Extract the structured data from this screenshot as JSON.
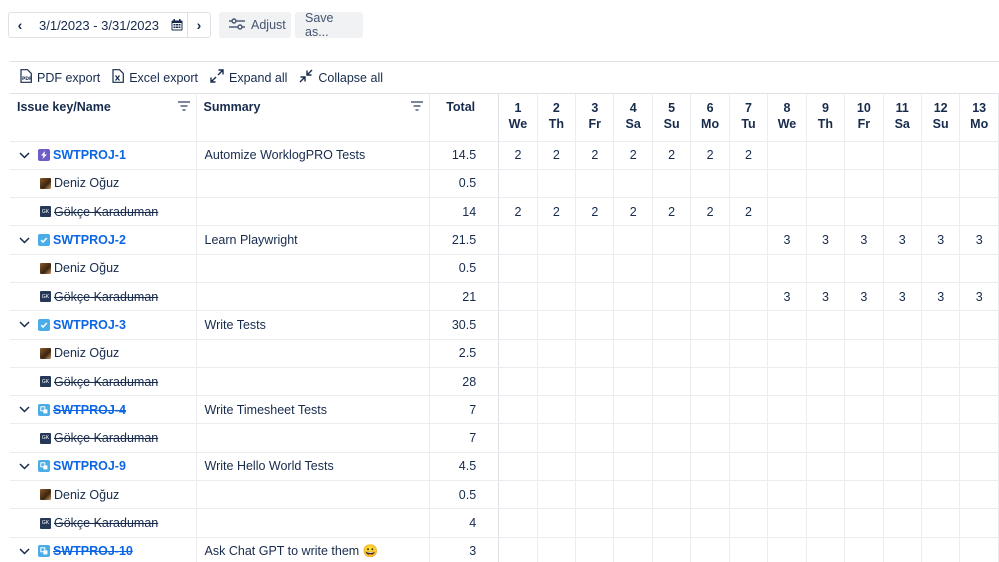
{
  "toolbar": {
    "prev_label": "‹",
    "date_range": "3/1/2023 - 3/31/2023",
    "next_label": "›",
    "adjust_label": "Adjust",
    "save_as_label": "Save as..."
  },
  "export_bar": {
    "pdf_label": "PDF export",
    "excel_label": "Excel export",
    "expand_label": "Expand all",
    "collapse_label": "Collapse all"
  },
  "table": {
    "headers": {
      "key": "Issue key/Name",
      "summary": "Summary",
      "total": "Total"
    },
    "days": [
      {
        "num": "1",
        "dow": "We"
      },
      {
        "num": "2",
        "dow": "Th"
      },
      {
        "num": "3",
        "dow": "Fr"
      },
      {
        "num": "4",
        "dow": "Sa"
      },
      {
        "num": "5",
        "dow": "Su"
      },
      {
        "num": "6",
        "dow": "Mo"
      },
      {
        "num": "7",
        "dow": "Tu"
      },
      {
        "num": "8",
        "dow": "We"
      },
      {
        "num": "9",
        "dow": "Th"
      },
      {
        "num": "10",
        "dow": "Fr"
      },
      {
        "num": "11",
        "dow": "Sa"
      },
      {
        "num": "12",
        "dow": "Su"
      },
      {
        "num": "13",
        "dow": "Mo"
      }
    ],
    "rows": [
      {
        "kind": "issue",
        "key": "SWTPROJ-1",
        "icon": "epic-icon",
        "icon_color": "#6e5dc6",
        "strike": false,
        "summary": "Automize WorklogPRO Tests",
        "total": "14.5",
        "days": [
          "2",
          "2",
          "2",
          "2",
          "2",
          "2",
          "2",
          "",
          "",
          "",
          "",
          "",
          ""
        ]
      },
      {
        "kind": "user",
        "name": "Deniz Oğuz",
        "avatar": "photo",
        "strike": false,
        "total": "0.5",
        "days": [
          "",
          "",
          "",
          "",
          "",
          "",
          "",
          "",
          "",
          "",
          "",
          "",
          ""
        ]
      },
      {
        "kind": "user",
        "name": "Gökçe Karaduman",
        "avatar": "GK",
        "strike": true,
        "total": "14",
        "days": [
          "2",
          "2",
          "2",
          "2",
          "2",
          "2",
          "2",
          "",
          "",
          "",
          "",
          "",
          ""
        ]
      },
      {
        "kind": "issue",
        "key": "SWTPROJ-2",
        "icon": "task-icon",
        "icon_color": "#4bade8",
        "strike": false,
        "summary": "Learn Playwright",
        "total": "21.5",
        "days": [
          "",
          "",
          "",
          "",
          "",
          "",
          "",
          "3",
          "3",
          "3",
          "3",
          "3",
          "3"
        ]
      },
      {
        "kind": "user",
        "name": "Deniz Oğuz",
        "avatar": "photo",
        "strike": false,
        "total": "0.5",
        "days": [
          "",
          "",
          "",
          "",
          "",
          "",
          "",
          "",
          "",
          "",
          "",
          "",
          ""
        ]
      },
      {
        "kind": "user",
        "name": "Gökçe Karaduman",
        "avatar": "GK",
        "strike": true,
        "total": "21",
        "days": [
          "",
          "",
          "",
          "",
          "",
          "",
          "",
          "3",
          "3",
          "3",
          "3",
          "3",
          "3"
        ]
      },
      {
        "kind": "issue",
        "key": "SWTPROJ-3",
        "icon": "task-icon",
        "icon_color": "#4bade8",
        "strike": false,
        "summary": "Write Tests",
        "total": "30.5",
        "days": [
          "",
          "",
          "",
          "",
          "",
          "",
          "",
          "",
          "",
          "",
          "",
          "",
          ""
        ]
      },
      {
        "kind": "user",
        "name": "Deniz Oğuz",
        "avatar": "photo",
        "strike": false,
        "total": "2.5",
        "days": [
          "",
          "",
          "",
          "",
          "",
          "",
          "",
          "",
          "",
          "",
          "",
          "",
          ""
        ]
      },
      {
        "kind": "user",
        "name": "Gökçe Karaduman",
        "avatar": "GK",
        "strike": true,
        "total": "28",
        "days": [
          "",
          "",
          "",
          "",
          "",
          "",
          "",
          "",
          "",
          "",
          "",
          "",
          ""
        ]
      },
      {
        "kind": "issue",
        "key": "SWTPROJ-4",
        "icon": "subtask-icon",
        "icon_color": "#4bade8",
        "strike": true,
        "summary": "Write Timesheet Tests",
        "total": "7",
        "days": [
          "",
          "",
          "",
          "",
          "",
          "",
          "",
          "",
          "",
          "",
          "",
          "",
          ""
        ]
      },
      {
        "kind": "user",
        "name": "Gökçe Karaduman",
        "avatar": "GK",
        "strike": true,
        "total": "7",
        "days": [
          "",
          "",
          "",
          "",
          "",
          "",
          "",
          "",
          "",
          "",
          "",
          "",
          ""
        ]
      },
      {
        "kind": "issue",
        "key": "SWTPROJ-9",
        "icon": "subtask-icon",
        "icon_color": "#4bade8",
        "strike": false,
        "summary": "Write Hello World Tests",
        "total": "4.5",
        "days": [
          "",
          "",
          "",
          "",
          "",
          "",
          "",
          "",
          "",
          "",
          "",
          "",
          ""
        ]
      },
      {
        "kind": "user",
        "name": "Deniz Oğuz",
        "avatar": "photo",
        "strike": false,
        "total": "0.5",
        "days": [
          "",
          "",
          "",
          "",
          "",
          "",
          "",
          "",
          "",
          "",
          "",
          "",
          ""
        ]
      },
      {
        "kind": "user",
        "name": "Gökçe Karaduman",
        "avatar": "GK",
        "strike": true,
        "total": "4",
        "days": [
          "",
          "",
          "",
          "",
          "",
          "",
          "",
          "",
          "",
          "",
          "",
          "",
          ""
        ]
      },
      {
        "kind": "issue",
        "key": "SWTPROJ-10",
        "icon": "subtask-icon",
        "icon_color": "#4bade8",
        "strike": true,
        "summary": "Ask Chat GPT to write them 😀",
        "total": "3",
        "days": [
          "",
          "",
          "",
          "",
          "",
          "",
          "",
          "",
          "",
          "",
          "",
          "",
          ""
        ]
      }
    ]
  }
}
